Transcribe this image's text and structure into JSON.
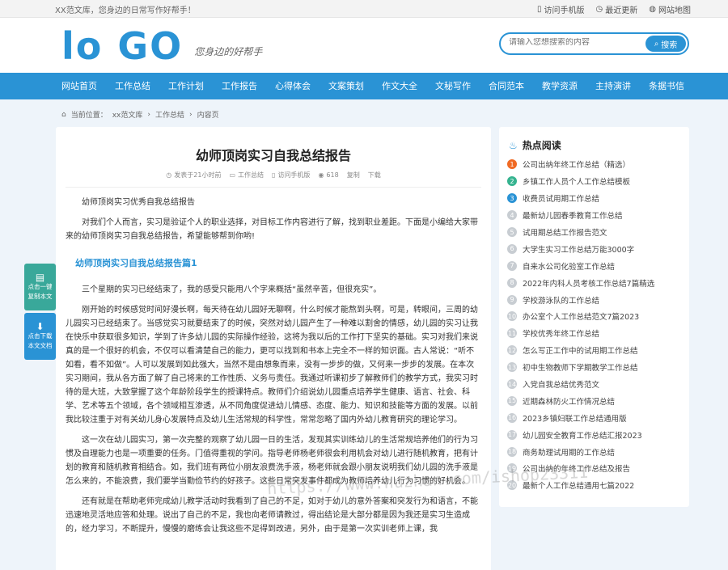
{
  "topbar": {
    "slogan": "XX范文库，您身边的日常写作好帮手！",
    "links": [
      "访问手机版",
      "最近更新",
      "网站地图"
    ]
  },
  "header": {
    "logo_text": "lo GO",
    "logo_tagline": "您身边的好帮手",
    "search_placeholder": "请输入您想搜索的内容",
    "search_button": "搜索"
  },
  "nav": [
    "网站首页",
    "工作总结",
    "工作计划",
    "工作报告",
    "心得体会",
    "文案策划",
    "作文大全",
    "文秘写作",
    "合同范本",
    "教学资源",
    "主持演讲",
    "条据书信"
  ],
  "breadcrumb": {
    "label": "当前位置：",
    "items": [
      "xx范文库",
      "工作总结",
      "内容页"
    ]
  },
  "article": {
    "title": "幼师顶岗实习自我总结报告",
    "meta": {
      "time": "发表于21小时前",
      "category": "工作总结",
      "mobile": "访问手机版",
      "views": "618",
      "copy": "复制",
      "download": "下载"
    },
    "paragraphs_intro": [
      "幼师顶岗实习优秀自我总结报告",
      "对我们个人而言，实习是验证个人的职业选择，对目标工作内容进行了解，找到职业差距。下面是小编给大家带来的幼师顶岗实习自我总结报告，希望能够帮到你哟!"
    ],
    "section_heading": "幼师顶岗实习自我总结报告篇1",
    "paragraphs_body": [
      "三个星期的实习已经结束了，我的感受只能用八个字来概括“虽然辛苦，但很充实”。",
      "刚开始的时候感觉时间好漫长啊，每天待在幼儿园好无聊啊，什么时候才能熬到头啊，可是，转眼间，三周的幼儿园实习已经结束了。当感觉实习就要结束了的时候，突然对幼儿园产生了一种难以割舍的情感，幼儿园的实习让我在快乐中获取很多知识，学到了许多幼儿园的实际操作经验，这将为我以后的工作打下坚实的基础。实习对我们来说真的是一个很好的机会，不仅可以看清楚自己的能力，更可以找到和书本上完全不一样的知识面。古人常说：“听不如看，看不如做”。人可以发展到如此强大，当然不是由想象而来，没有一步步的做，又何来一步步的发展。在本次实习期间，我从各方面了解了自己将来的工作性质、义务与责任。我通过听课初步了解教师们的教学方式，我实习时待的是大班，大致掌握了这个年龄阶段学生的授课特点。教师们介绍说幼儿园重点培养学生健康、语言、社会、科学、艺术等五个领域，各个领域相互渗透，从不同角度促进幼儿情感、态度、能力、知识和技能等方面的发展。以前我比较注重于对有关幼儿身心发展特点及幼儿生活常规的科学性，常常忽略了国内外幼儿教育研究的理论学习。",
      "这一次在幼儿园实习，第一次完整的观察了幼儿园一日的生活，发现其实训练幼儿的生活常规培养他们的行为习惯及自理能力也是一项重要的任务。门值得重视的学问。指导老师杨老师很会利用机会对幼儿进行随机教育，把有计划的教育和随机教育相结合。如，我们班有两位小朋友浪费洗手液，杨老师就会跟小朋友说明我们幼儿园的洗手液是怎么来的，不能浪费，我们要学当勤俭节约的好孩子。这些日常突发事件都成为教师培养幼儿行为习惯的好机会。",
      "还有就是在帮助老师完成幼儿教学活动时我看到了自己的不足，如对于幼儿的意外答案和突发行为和语言，不能迅速地灵活地应答和处理。说出了自己的不足，我也向老师请教过，得出结论是大部分都是因为我还是实习生造成的，经力学习，不断提升，慢慢的磨练会让我这些不足得到改进，另外，由于是第一次实训老师上课，我"
    ]
  },
  "sidebar": {
    "title": "热点阅读",
    "items": [
      "公司出纳年终工作总结（精选）",
      "乡镇工作人员个人工作总结模板",
      "收费员试用期工作总结",
      "最新幼儿园春季教育工作总结",
      "试用期总结工作报告范文",
      "大学生实习工作总结万能3000字",
      "自来水公司化验室工作总结",
      "2022年内科人员考核工作总结7篇精选",
      "学校游泳队的工作总结",
      "办公室个人工作总结范文7篇2023",
      "学校优秀年终工作总结",
      "怎么写正工作中的试用期工作总结",
      "初中生物教师下学期教学工作总结",
      "入党自我总结优秀范文",
      "近期森林防火工作情况总结",
      "2023乡镇妇联工作总结通用版",
      "幼儿园安全教育工作总结汇报2023",
      "商务助理试用期的工作总结",
      "公司出纳的年终工作总结及报告",
      "最新个人工作总结通用七篇2022"
    ]
  },
  "float_buttons": [
    {
      "label1": "点击一键",
      "label2": "复制本文"
    },
    {
      "label1": "点击下载",
      "label2": "本文文档"
    }
  ],
  "watermark": "https://www.huzhan.com/ishop23311"
}
